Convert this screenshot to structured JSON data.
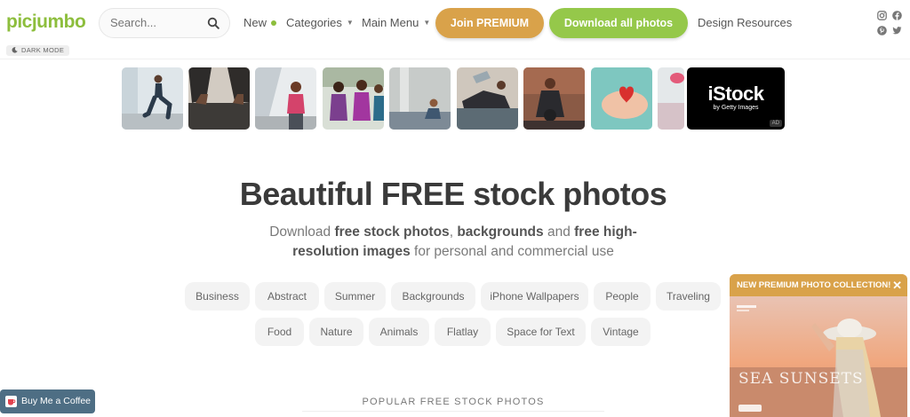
{
  "header": {
    "logo": "picjumbo",
    "search_placeholder": "Search...",
    "nav": {
      "new": "New",
      "categories": "Categories",
      "main_menu": "Main Menu"
    },
    "join_premium": "Join PREMIUM",
    "download_all": "Download all photos",
    "design_resources": "Design Resources",
    "dark_mode": "DARK MODE",
    "social_icons": [
      "instagram-icon",
      "facebook-icon",
      "pinterest-icon",
      "twitter-icon"
    ]
  },
  "ad": {
    "brand": "iStock",
    "brand_sub": "by Getty Images",
    "tag": "AD"
  },
  "hero": {
    "title": "Beautiful FREE stock photos",
    "sub_1": "Download ",
    "sub_2": "free stock photos",
    "sub_3": ", ",
    "sub_4": "backgrounds",
    "sub_5": " and ",
    "sub_6": "free high-resolution images",
    "sub_7": " for personal and commercial use"
  },
  "categories_row1": [
    "Business",
    "Abstract",
    "Summer",
    "Backgrounds",
    "iPhone Wallpapers",
    "People",
    "Traveling"
  ],
  "categories_row2": [
    "Food",
    "Nature",
    "Animals",
    "Flatlay",
    "Space for Text",
    "Vintage"
  ],
  "popup": {
    "title": "NEW PREMIUM PHOTO COLLECTION!",
    "close": "✕",
    "image_text": "SEA SUNSETS"
  },
  "popular_heading": "POPULAR FREE STOCK PHOTOS",
  "coffee_button": "Buy Me a Coffee",
  "colors": {
    "brand_green": "#8dbe3d",
    "premium_gold": "#d9a24a",
    "download_green": "#95c84a",
    "coffee_blue": "#4e6e84"
  }
}
